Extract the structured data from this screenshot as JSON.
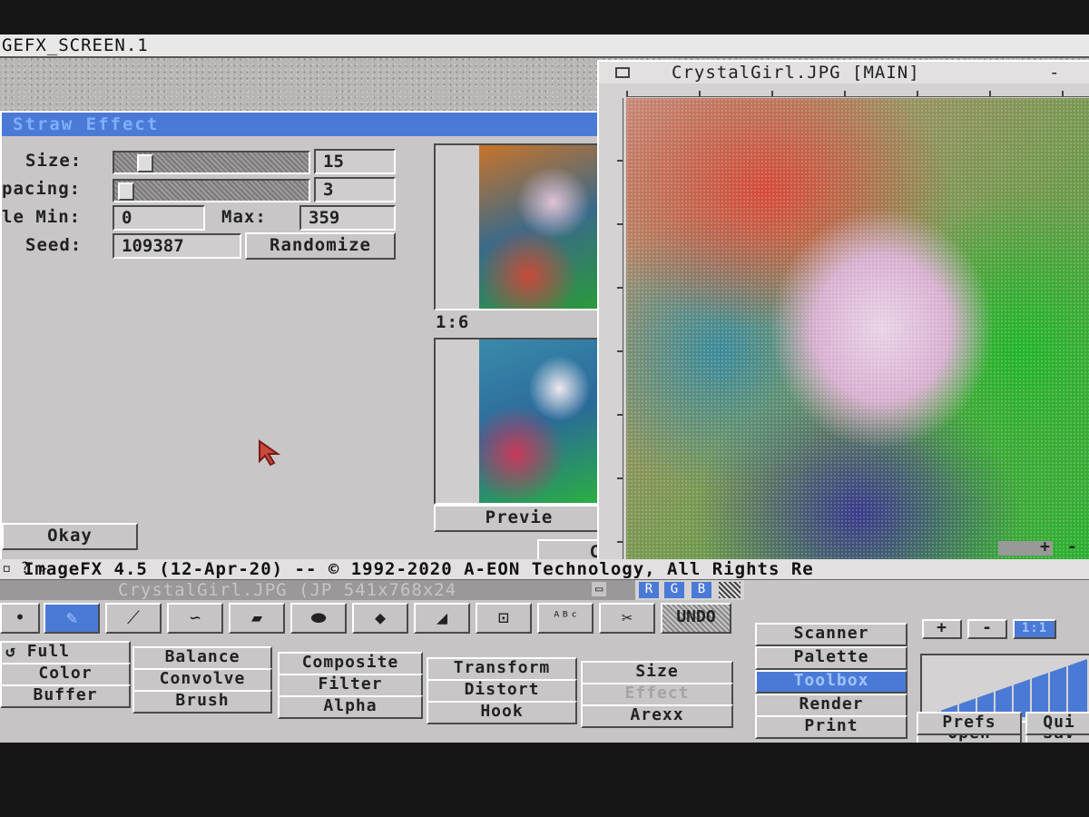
{
  "screen": {
    "title": "GEFX_SCREEN.1"
  },
  "dialog": {
    "title": "Straw Effect",
    "size_label": "Size:",
    "size_value": "15",
    "size_fraction": 0.13,
    "spacing_label": "pacing:",
    "spacing_value": "3",
    "spacing_fraction": 0.02,
    "min_label": "le Min:",
    "min_value": "0",
    "max_label": "Max:",
    "max_value": "359",
    "seed_label": "Seed:",
    "seed_value": "109387",
    "randomize_label": "Randomize",
    "ratio": "1:6",
    "preview_label": "Previe",
    "okay_label": "Okay",
    "cancel_label": "Cancel"
  },
  "image_window": {
    "title": "CrystalGirl.JPG [MAIN]"
  },
  "main": {
    "info": "ImageFX 4.5  (12-Apr-20) -- © 1992-2020 A-EON Technology, All Rights Re",
    "file_info": "CrystalGirl.JPG (JP  541x768x24",
    "rgb": [
      "R",
      "G",
      "B"
    ],
    "undo_label": "UNDO",
    "left_buttons": [
      "Full",
      "Color",
      "Buffer"
    ],
    "col1": [
      "Balance",
      "Convolve",
      "Brush"
    ],
    "col2": [
      "Composite",
      "Filter",
      "Alpha"
    ],
    "col3": [
      "Transform",
      "Distort",
      "Hook"
    ],
    "col4": [
      "Size",
      "Effect",
      "Arexx"
    ],
    "modules": [
      "Scanner",
      "Palette",
      "Toolbox",
      "Render",
      "Print"
    ],
    "right_buttons": [
      "Open",
      "Sav",
      "Prefs",
      "Qui"
    ],
    "zoom": [
      "+",
      "-",
      "1:1"
    ]
  }
}
